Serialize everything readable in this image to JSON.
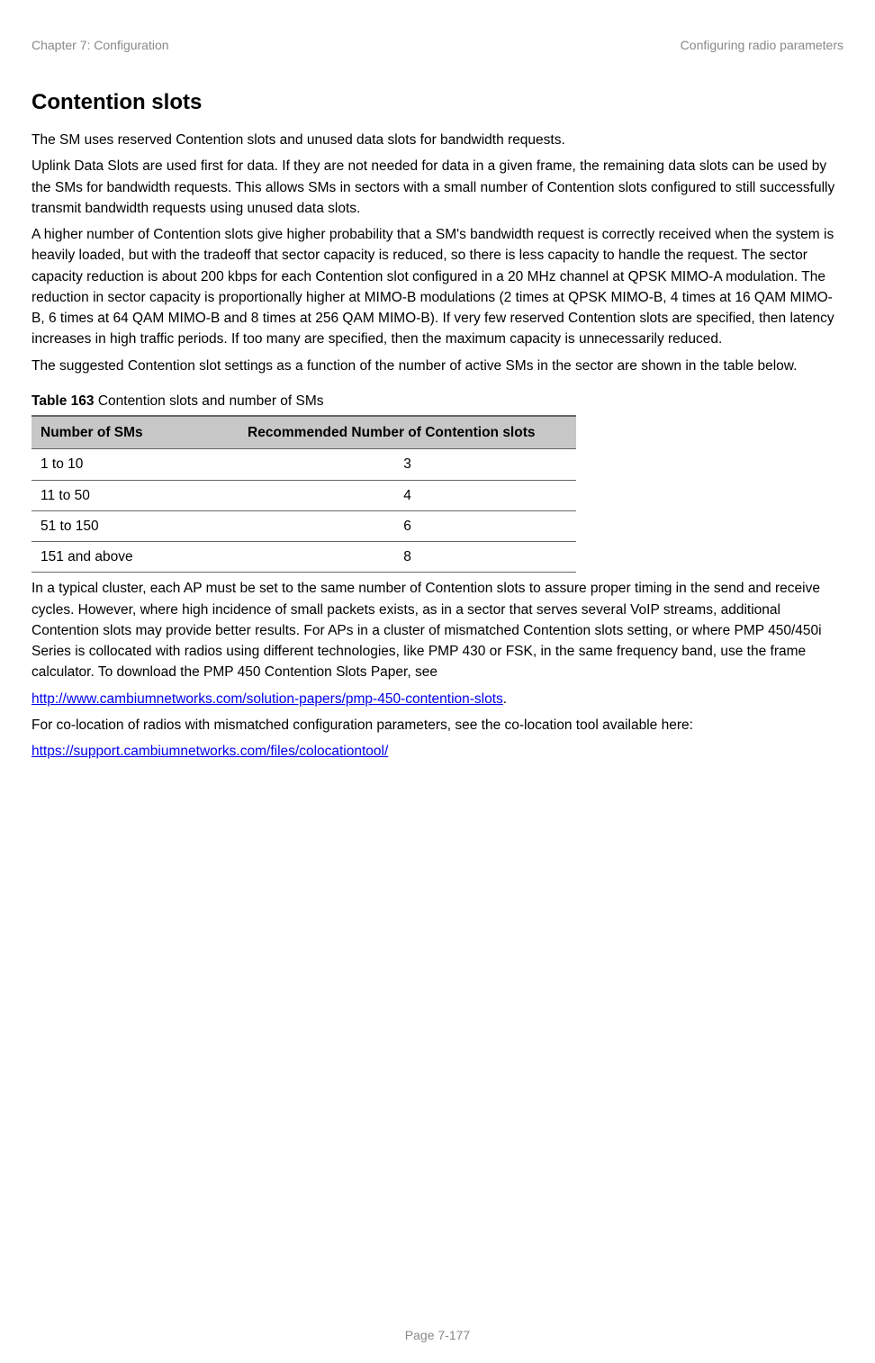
{
  "header": {
    "left": "Chapter 7:  Configuration",
    "right": "Configuring radio parameters"
  },
  "section_title": "Contention slots",
  "para1": "The SM uses reserved Contention slots and unused data slots for bandwidth requests.",
  "para2": "Uplink Data Slots are used first for data. If they are not needed for data in a given frame, the remaining data slots can be used by the SMs for bandwidth requests. This allows SMs in sectors with a small number of Contention slots configured to still successfully transmit bandwidth requests using unused data slots.",
  "para3": "A higher number of Contention slots give higher probability that a SM's bandwidth request is correctly received when the system is heavily loaded, but with the tradeoff that sector capacity is reduced, so there is less capacity to handle the request. The sector capacity reduction is about 200 kbps for each Contention slot configured in a 20 MHz channel at QPSK MIMO-A modulation. The reduction in sector capacity is proportionally higher at MIMO-B modulations (2 times at QPSK MIMO-B, 4 times at 16 QAM MIMO-B, 6 times at 64 QAM MIMO-B and 8 times at 256 QAM MIMO-B). If very few reserved Contention slots are specified, then latency increases in high traffic periods. If too many are specified, then the maximum capacity is unnecessarily reduced.",
  "para4": "The suggested Contention slot settings as a function of the number of active SMs in the sector are shown in the table below.",
  "table": {
    "caption_bold": "Table 163",
    "caption_rest": " Contention slots and number of SMs",
    "headers": {
      "col1": "Number of SMs",
      "col2": "Recommended Number of Contention slots"
    },
    "rows": [
      {
        "sms": "1 to 10",
        "rec": "3"
      },
      {
        "sms": "11 to 50",
        "rec": "4"
      },
      {
        "sms": "51 to 150",
        "rec": "6"
      },
      {
        "sms": "151 and above",
        "rec": "8"
      }
    ]
  },
  "para5": "In a typical cluster, each AP must be set to the same number of Contention slots to assure proper timing in the send and receive cycles. However, where high incidence of small packets exists, as in a sector that serves several VoIP streams, additional Contention slots may provide better results. For APs in a cluster of mismatched Contention slots setting, or where PMP 450/450i Series is collocated with radios using different technologies, like PMP 430 or FSK, in the same frequency band, use the frame calculator. To download the PMP 450 Contention Slots Paper, see",
  "link1": "http://www.cambiumnetworks.com/solution-papers/pmp-450-contention-slots",
  "link1_suffix": ".",
  "para6": "For co-location of radios with mismatched configuration parameters, see the co-location tool available here:",
  "link2": "https://support.cambiumnetworks.com/files/colocationtool/",
  "footer": "Page 7-177"
}
